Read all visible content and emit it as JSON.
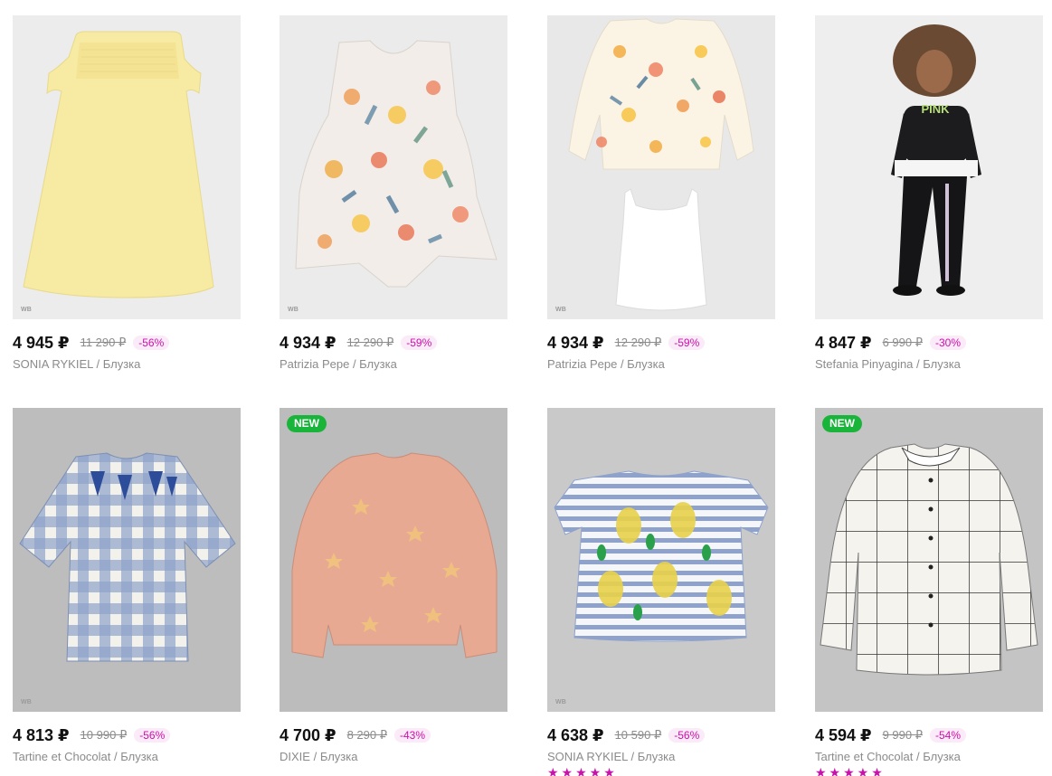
{
  "products": [
    {
      "price": "4 945 ₽",
      "old_price": "11 290 ₽",
      "discount": "-56%",
      "brand": "SONIA RYKIEL",
      "sep": " / ",
      "category": "Блузка",
      "wb": "WB",
      "badge": ""
    },
    {
      "price": "4 934 ₽",
      "old_price": "12 290 ₽",
      "discount": "-59%",
      "brand": "Patrizia Pepe",
      "sep": " / ",
      "category": "Блузка",
      "wb": "WB",
      "badge": ""
    },
    {
      "price": "4 934 ₽",
      "old_price": "12 290 ₽",
      "discount": "-59%",
      "brand": "Patrizia Pepe",
      "sep": " / ",
      "category": "Блузка",
      "wb": "WB",
      "badge": ""
    },
    {
      "price": "4 847 ₽",
      "old_price": "6 990 ₽",
      "discount": "-30%",
      "brand": "Stefania Pinyagina",
      "sep": " / ",
      "category": "Блузка",
      "wb": "",
      "badge": "",
      "print_text": "PINK"
    },
    {
      "price": "4 813 ₽",
      "old_price": "10 990 ₽",
      "discount": "-56%",
      "brand": "Tartine et Chocolat",
      "sep": " / ",
      "category": "Блузка",
      "wb": "WB",
      "badge": ""
    },
    {
      "price": "4 700 ₽",
      "old_price": "8 290 ₽",
      "discount": "-43%",
      "brand": "DIXIE",
      "sep": " / ",
      "category": "Блузка",
      "wb": "",
      "badge": "NEW"
    },
    {
      "price": "4 638 ₽",
      "old_price": "10 590 ₽",
      "discount": "-56%",
      "brand": "SONIA RYKIEL",
      "sep": " / ",
      "category": "Блузка",
      "wb": "WB",
      "badge": "",
      "stars": "★★★★★"
    },
    {
      "price": "4 594 ₽",
      "old_price": "9 990 ₽",
      "discount": "-54%",
      "brand": "Tartine et Chocolat",
      "sep": " / ",
      "category": "Блузка",
      "wb": "",
      "badge": "NEW",
      "stars": "★★★★★"
    }
  ],
  "colors": {
    "accent": "#cb11ab",
    "new_badge": "#19b43a",
    "price": "#111111",
    "muted": "#8b8b8b"
  }
}
